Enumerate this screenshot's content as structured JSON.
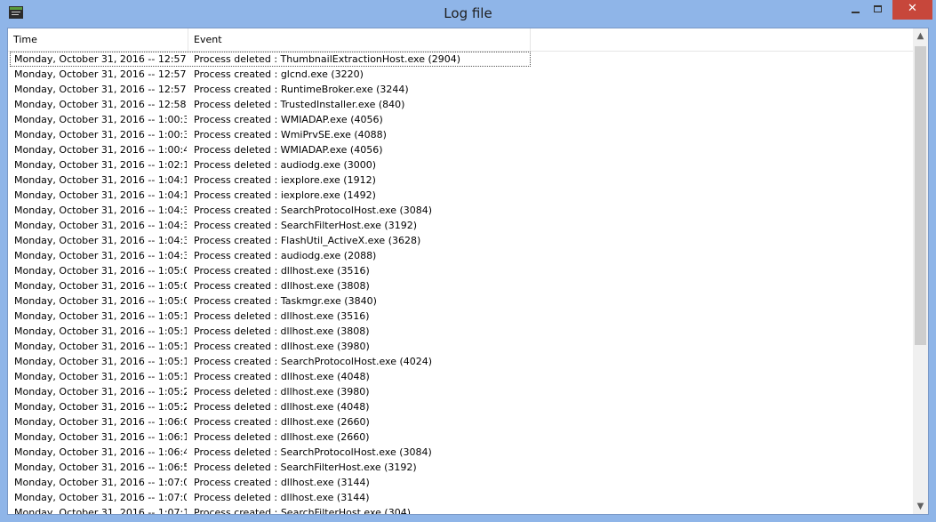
{
  "window": {
    "title": "Log file",
    "close_glyph": "✕",
    "icon": "app-icon",
    "accent": "#8fb5e8",
    "close_color": "#c7473b"
  },
  "columns": {
    "time": "Time",
    "event": "Event"
  },
  "rows": [
    {
      "time": "Monday, October 31, 2016 -- 12:57:...",
      "event": "Process deleted : ThumbnailExtractionHost.exe (2904)"
    },
    {
      "time": "Monday, October 31, 2016 -- 12:57:...",
      "event": "Process created : glcnd.exe (3220)"
    },
    {
      "time": "Monday, October 31, 2016 -- 12:57:...",
      "event": "Process created : RuntimeBroker.exe (3244)"
    },
    {
      "time": "Monday, October 31, 2016 -- 12:58:...",
      "event": "Process deleted : TrustedInstaller.exe (840)"
    },
    {
      "time": "Monday, October 31, 2016 -- 1:00:3...",
      "event": "Process created : WMIADAP.exe (4056)"
    },
    {
      "time": "Monday, October 31, 2016 -- 1:00:3...",
      "event": "Process created : WmiPrvSE.exe (4088)"
    },
    {
      "time": "Monday, October 31, 2016 -- 1:00:4...",
      "event": "Process deleted : WMIADAP.exe (4056)"
    },
    {
      "time": "Monday, October 31, 2016 -- 1:02:1...",
      "event": "Process deleted : audiodg.exe (3000)"
    },
    {
      "time": "Monday, October 31, 2016 -- 1:04:1...",
      "event": "Process created : iexplore.exe (1912)"
    },
    {
      "time": "Monday, October 31, 2016 -- 1:04:1...",
      "event": "Process created : iexplore.exe (1492)"
    },
    {
      "time": "Monday, October 31, 2016 -- 1:04:3...",
      "event": "Process created : SearchProtocolHost.exe (3084)"
    },
    {
      "time": "Monday, October 31, 2016 -- 1:04:3...",
      "event": "Process created : SearchFilterHost.exe (3192)"
    },
    {
      "time": "Monday, October 31, 2016 -- 1:04:3...",
      "event": "Process created : FlashUtil_ActiveX.exe (3628)"
    },
    {
      "time": "Monday, October 31, 2016 -- 1:04:3...",
      "event": "Process created : audiodg.exe (2088)"
    },
    {
      "time": "Monday, October 31, 2016 -- 1:05:0...",
      "event": "Process created : dllhost.exe (3516)"
    },
    {
      "time": "Monday, October 31, 2016 -- 1:05:0...",
      "event": "Process created : dllhost.exe (3808)"
    },
    {
      "time": "Monday, October 31, 2016 -- 1:05:0...",
      "event": "Process created : Taskmgr.exe (3840)"
    },
    {
      "time": "Monday, October 31, 2016 -- 1:05:1...",
      "event": "Process deleted : dllhost.exe (3516)"
    },
    {
      "time": "Monday, October 31, 2016 -- 1:05:1...",
      "event": "Process deleted : dllhost.exe (3808)"
    },
    {
      "time": "Monday, October 31, 2016 -- 1:05:1...",
      "event": "Process created : dllhost.exe (3980)"
    },
    {
      "time": "Monday, October 31, 2016 -- 1:05:1...",
      "event": "Process created : SearchProtocolHost.exe (4024)"
    },
    {
      "time": "Monday, October 31, 2016 -- 1:05:1...",
      "event": "Process created : dllhost.exe (4048)"
    },
    {
      "time": "Monday, October 31, 2016 -- 1:05:2...",
      "event": "Process deleted : dllhost.exe (3980)"
    },
    {
      "time": "Monday, October 31, 2016 -- 1:05:2...",
      "event": "Process deleted : dllhost.exe (4048)"
    },
    {
      "time": "Monday, October 31, 2016 -- 1:06:0...",
      "event": "Process created : dllhost.exe (2660)"
    },
    {
      "time": "Monday, October 31, 2016 -- 1:06:1...",
      "event": "Process deleted : dllhost.exe (2660)"
    },
    {
      "time": "Monday, October 31, 2016 -- 1:06:4...",
      "event": "Process deleted : SearchProtocolHost.exe (3084)"
    },
    {
      "time": "Monday, October 31, 2016 -- 1:06:5...",
      "event": "Process deleted : SearchFilterHost.exe (3192)"
    },
    {
      "time": "Monday, October 31, 2016 -- 1:07:0...",
      "event": "Process created : dllhost.exe (3144)"
    },
    {
      "time": "Monday, October 31, 2016 -- 1:07:0...",
      "event": "Process deleted : dllhost.exe (3144)"
    },
    {
      "time": "Monday, October 31, 2016 -- 1:07:1...",
      "event": "Process created : SearchFilterHost.exe (304)"
    }
  ],
  "scrollbar": {
    "up_glyph": "▲",
    "down_glyph": "▼"
  }
}
